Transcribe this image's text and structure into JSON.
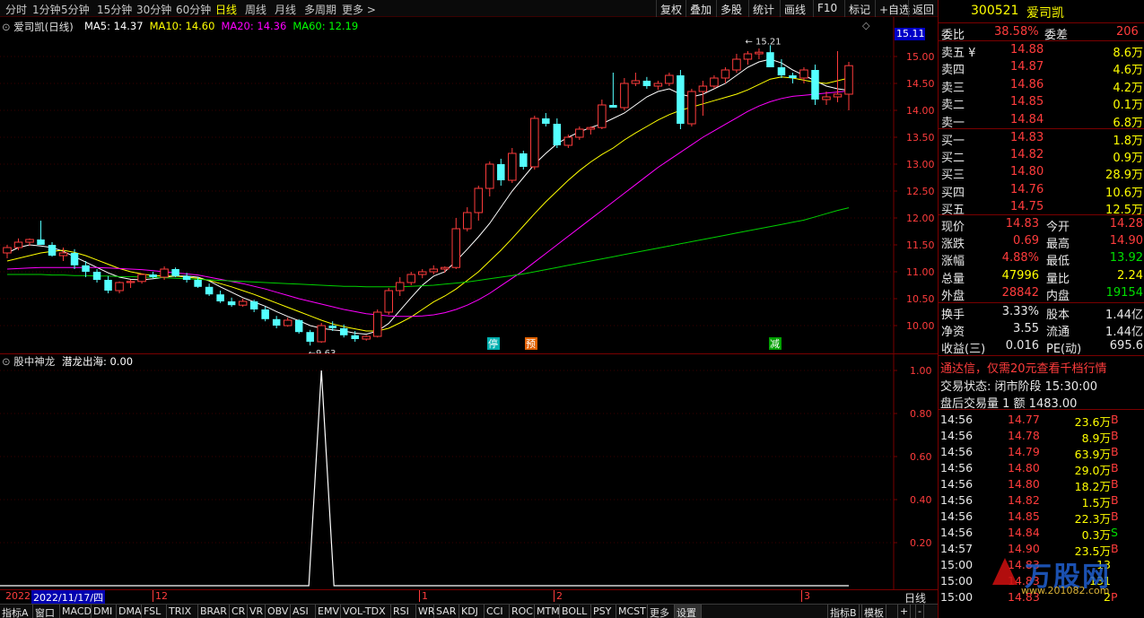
{
  "toolbar": {
    "periods": [
      "分时",
      "1分钟",
      "5分钟",
      "15分钟",
      "30分钟",
      "60分钟",
      "日线",
      "周线",
      "月线",
      "多周期",
      "更多 >"
    ],
    "active_period": "日线",
    "right_buttons": [
      "复权",
      "叠加",
      "多股",
      "统计",
      "画线",
      "F10",
      "标记",
      "+自选",
      "返回"
    ]
  },
  "kline": {
    "title": "爱司凯(日线)",
    "ma": [
      {
        "label": "MA5: 14.37",
        "color": "#ffffff"
      },
      {
        "label": "MA10: 14.60",
        "color": "#ffff00"
      },
      {
        "label": "MA20: 14.36",
        "color": "#ff00ff"
      },
      {
        "label": "MA60: 12.19",
        "color": "#00ff00"
      }
    ],
    "current_price_tag": "15.11",
    "high_annotation": "15.21",
    "low_annotation": "9.63",
    "signals": [
      "停",
      "预",
      "减"
    ]
  },
  "chart_data": {
    "type": "candlestick",
    "y_axis": {
      "labels": [
        "15.00",
        "14.50",
        "14.00",
        "13.50",
        "13.00",
        "12.50",
        "12.00",
        "11.50",
        "11.00",
        "10.50",
        "10.00"
      ],
      "range": [
        9.6,
        15.4
      ]
    },
    "candles": [
      [
        11.35,
        11.5,
        11.25,
        11.45
      ],
      [
        11.45,
        11.62,
        11.4,
        11.55
      ],
      [
        11.55,
        11.62,
        11.48,
        11.6
      ],
      [
        11.6,
        11.95,
        11.55,
        11.5
      ],
      [
        11.5,
        11.55,
        11.28,
        11.3
      ],
      [
        11.3,
        11.45,
        11.2,
        11.35
      ],
      [
        11.35,
        11.42,
        11.05,
        11.12
      ],
      [
        11.12,
        11.2,
        10.9,
        11.0
      ],
      [
        11.0,
        11.05,
        10.8,
        10.85
      ],
      [
        10.85,
        10.92,
        10.6,
        10.65
      ],
      [
        10.65,
        10.82,
        10.6,
        10.8
      ],
      [
        10.8,
        10.85,
        10.7,
        10.82
      ],
      [
        10.82,
        10.97,
        10.78,
        10.95
      ],
      [
        10.95,
        11.0,
        10.88,
        10.9
      ],
      [
        10.9,
        11.1,
        10.85,
        11.05
      ],
      [
        11.05,
        11.08,
        10.9,
        10.92
      ],
      [
        10.92,
        10.98,
        10.8,
        10.85
      ],
      [
        10.85,
        10.9,
        10.7,
        10.72
      ],
      [
        10.72,
        10.78,
        10.55,
        10.58
      ],
      [
        10.58,
        10.65,
        10.42,
        10.45
      ],
      [
        10.45,
        10.52,
        10.35,
        10.38
      ],
      [
        10.38,
        10.5,
        10.35,
        10.45
      ],
      [
        10.45,
        10.48,
        10.25,
        10.3
      ],
      [
        10.3,
        10.35,
        10.08,
        10.12
      ],
      [
        10.12,
        10.18,
        9.95,
        10.0
      ],
      [
        10.0,
        10.15,
        9.98,
        10.1
      ],
      [
        10.1,
        10.12,
        9.85,
        9.88
      ],
      [
        9.88,
        9.92,
        9.63,
        9.7
      ],
      [
        9.7,
        10.05,
        9.68,
        10.0
      ],
      [
        10.0,
        10.08,
        9.9,
        9.95
      ],
      [
        9.95,
        10.02,
        9.78,
        9.82
      ],
      [
        9.82,
        9.9,
        9.7,
        9.75
      ],
      [
        9.75,
        9.82,
        9.72,
        9.8
      ],
      [
        9.8,
        10.3,
        9.78,
        10.25
      ],
      [
        10.25,
        10.7,
        10.2,
        10.65
      ],
      [
        10.65,
        10.9,
        10.55,
        10.8
      ],
      [
        10.8,
        11.0,
        10.75,
        10.95
      ],
      [
        10.95,
        11.05,
        10.88,
        11.0
      ],
      [
        11.0,
        11.12,
        10.95,
        11.05
      ],
      [
        11.05,
        11.1,
        10.98,
        11.08
      ],
      [
        11.08,
        12.0,
        11.05,
        11.8
      ],
      [
        11.8,
        12.2,
        11.75,
        12.1
      ],
      [
        12.1,
        12.6,
        11.95,
        12.55
      ],
      [
        12.55,
        13.05,
        12.4,
        13.0
      ],
      [
        13.0,
        13.1,
        12.6,
        12.7
      ],
      [
        12.7,
        13.3,
        12.65,
        13.2
      ],
      [
        13.2,
        13.25,
        12.9,
        12.95
      ],
      [
        12.95,
        13.9,
        12.9,
        13.85
      ],
      [
        13.85,
        13.95,
        13.7,
        13.75
      ],
      [
        13.75,
        13.85,
        13.3,
        13.35
      ],
      [
        13.35,
        13.55,
        13.3,
        13.5
      ],
      [
        13.5,
        13.7,
        13.45,
        13.65
      ],
      [
        13.65,
        13.7,
        13.55,
        13.68
      ],
      [
        13.68,
        14.2,
        13.65,
        14.1
      ],
      [
        14.1,
        14.7,
        14.05,
        14.05
      ],
      [
        14.05,
        14.6,
        14.0,
        14.5
      ],
      [
        14.5,
        14.7,
        14.45,
        14.55
      ],
      [
        14.55,
        14.62,
        14.4,
        14.45
      ],
      [
        14.45,
        14.55,
        14.38,
        14.5
      ],
      [
        14.5,
        14.7,
        14.45,
        14.65
      ],
      [
        14.65,
        14.75,
        13.65,
        13.75
      ],
      [
        13.75,
        14.4,
        13.7,
        14.35
      ],
      [
        14.35,
        14.55,
        13.9,
        14.45
      ],
      [
        14.45,
        14.65,
        14.4,
        14.6
      ],
      [
        14.6,
        14.8,
        14.5,
        14.75
      ],
      [
        14.75,
        15.05,
        14.7,
        14.95
      ],
      [
        14.95,
        15.1,
        14.85,
        15.05
      ],
      [
        15.05,
        15.15,
        14.95,
        15.08
      ],
      [
        15.08,
        15.21,
        14.95,
        14.8
      ],
      [
        14.8,
        14.95,
        14.6,
        14.65
      ],
      [
        14.65,
        14.7,
        14.5,
        14.6
      ],
      [
        14.6,
        14.8,
        14.5,
        14.75
      ],
      [
        14.75,
        14.85,
        14.1,
        14.2
      ],
      [
        14.2,
        14.35,
        14.1,
        14.25
      ],
      [
        14.25,
        15.1,
        14.15,
        14.3
      ],
      [
        14.3,
        14.9,
        14.0,
        14.83
      ]
    ],
    "ma_lines": {
      "MA5": [
        11.35,
        11.45,
        11.5,
        11.48,
        11.45,
        11.38,
        11.28,
        11.18,
        11.08,
        10.98,
        10.9,
        10.86,
        10.85,
        10.87,
        10.9,
        10.92,
        10.92,
        10.9,
        10.83,
        10.72,
        10.62,
        10.52,
        10.44,
        10.36,
        10.26,
        10.17,
        10.09,
        10.0,
        9.95,
        9.92,
        9.9,
        9.86,
        9.84,
        9.9,
        10.04,
        10.28,
        10.52,
        10.75,
        10.92,
        11.0,
        11.2,
        11.42,
        11.65,
        11.9,
        12.2,
        12.5,
        12.75,
        13.0,
        13.2,
        13.38,
        13.5,
        13.6,
        13.68,
        13.75,
        13.85,
        13.95,
        14.1,
        14.25,
        14.35,
        14.4,
        14.3,
        14.25,
        14.3,
        14.4,
        14.5,
        14.65,
        14.8,
        14.9,
        14.95,
        14.88,
        14.75,
        14.65,
        14.55,
        14.45,
        14.4,
        14.37
      ],
      "MA10": [
        11.2,
        11.25,
        11.3,
        11.35,
        11.38,
        11.4,
        11.36,
        11.3,
        11.22,
        11.14,
        11.06,
        11.0,
        10.96,
        10.93,
        10.92,
        10.92,
        10.9,
        10.88,
        10.84,
        10.78,
        10.72,
        10.65,
        10.58,
        10.5,
        10.42,
        10.34,
        10.26,
        10.18,
        10.1,
        10.03,
        9.98,
        9.94,
        9.9,
        9.9,
        9.95,
        10.05,
        10.16,
        10.3,
        10.44,
        10.55,
        10.68,
        10.84,
        11.0,
        11.2,
        11.4,
        11.62,
        11.85,
        12.08,
        12.3,
        12.5,
        12.7,
        12.88,
        13.04,
        13.18,
        13.3,
        13.45,
        13.58,
        13.7,
        13.82,
        13.92,
        14.0,
        14.06,
        14.12,
        14.18,
        14.24,
        14.3,
        14.38,
        14.48,
        14.58,
        14.62,
        14.6,
        14.56,
        14.52,
        14.5,
        14.55,
        14.6
      ],
      "MA20": [
        11.05,
        11.06,
        11.07,
        11.08,
        11.08,
        11.08,
        11.08,
        11.08,
        11.08,
        11.07,
        11.06,
        11.05,
        11.04,
        11.02,
        11.0,
        10.98,
        10.96,
        10.94,
        10.9,
        10.86,
        10.82,
        10.78,
        10.73,
        10.68,
        10.62,
        10.56,
        10.5,
        10.45,
        10.4,
        10.35,
        10.3,
        10.26,
        10.22,
        10.2,
        10.18,
        10.17,
        10.17,
        10.18,
        10.2,
        10.24,
        10.3,
        10.38,
        10.48,
        10.6,
        10.74,
        10.88,
        11.02,
        11.18,
        11.34,
        11.5,
        11.66,
        11.82,
        11.98,
        12.14,
        12.3,
        12.46,
        12.62,
        12.78,
        12.94,
        13.08,
        13.22,
        13.36,
        13.5,
        13.62,
        13.74,
        13.86,
        13.98,
        14.08,
        14.16,
        14.22,
        14.26,
        14.28,
        14.3,
        14.32,
        14.34,
        14.36
      ],
      "MA60": [
        10.95,
        10.95,
        10.95,
        10.95,
        10.94,
        10.94,
        10.93,
        10.93,
        10.92,
        10.92,
        10.91,
        10.91,
        10.9,
        10.9,
        10.89,
        10.88,
        10.87,
        10.86,
        10.85,
        10.84,
        10.83,
        10.82,
        10.81,
        10.8,
        10.79,
        10.78,
        10.77,
        10.76,
        10.75,
        10.74,
        10.73,
        10.73,
        10.72,
        10.72,
        10.72,
        10.72,
        10.73,
        10.74,
        10.75,
        10.77,
        10.79,
        10.81,
        10.84,
        10.87,
        10.9,
        10.93,
        10.96,
        11.0,
        11.04,
        11.08,
        11.12,
        11.16,
        11.2,
        11.24,
        11.28,
        11.32,
        11.36,
        11.4,
        11.44,
        11.48,
        11.52,
        11.56,
        11.6,
        11.64,
        11.68,
        11.72,
        11.76,
        11.8,
        11.84,
        11.88,
        11.92,
        11.96,
        12.02,
        12.08,
        12.14,
        12.19
      ]
    },
    "indicator": {
      "title": "股中神龙",
      "series_label": "潜龙出海: 0.00",
      "y_labels": [
        "1.00",
        "0.80",
        "0.60",
        "0.40",
        "0.20"
      ],
      "spike_index": 28,
      "spike_value": 1.0
    }
  },
  "datestrip": {
    "year": "2022",
    "cursor_date": "2022/11/17/四",
    "months": [
      "12",
      "1",
      "2",
      "3"
    ],
    "period": "日线"
  },
  "indicator_tabs": [
    "指标A",
    "窗口",
    "MACD",
    "DMI",
    "DMA",
    "FSL",
    "TRIX",
    "BRAR",
    "CR",
    "VR",
    "OBV",
    "ASI",
    "EMV",
    "VOL-TDX",
    "RSI",
    "WR",
    "SAR",
    "KDJ",
    "CCI",
    "ROC",
    "MTM",
    "BOLL",
    "PSY",
    "MCST",
    "更多",
    "设置"
  ],
  "indicator_tabs_right": [
    "指标B",
    "模板",
    "+",
    "-"
  ],
  "quote": {
    "code": "300521",
    "name": "爱司凯",
    "weibi_label": "委比",
    "weibi_value": "38.58%",
    "weicha_label": "委差",
    "weicha_value": "206",
    "sell": [
      {
        "label": "卖五 ¥",
        "price": "14.88",
        "vol": "8.6万"
      },
      {
        "label": "卖四",
        "price": "14.87",
        "vol": "4.6万"
      },
      {
        "label": "卖三",
        "price": "14.86",
        "vol": "4.2万"
      },
      {
        "label": "卖二",
        "price": "14.85",
        "vol": "0.1万"
      },
      {
        "label": "卖一",
        "price": "14.84",
        "vol": "6.8万"
      }
    ],
    "buy": [
      {
        "label": "买一",
        "price": "14.83",
        "vol": "1.8万"
      },
      {
        "label": "买二",
        "price": "14.82",
        "vol": "0.9万"
      },
      {
        "label": "买三",
        "price": "14.80",
        "vol": "28.9万"
      },
      {
        "label": "买四",
        "price": "14.76",
        "vol": "10.6万"
      },
      {
        "label": "买五",
        "price": "14.75",
        "vol": "12.5万"
      }
    ],
    "stats": [
      {
        "l1": "现价",
        "v1": "14.83",
        "l2": "今开",
        "v2": "14.28"
      },
      {
        "l1": "涨跌",
        "v1": "0.69",
        "l2": "最高",
        "v2": "14.90"
      },
      {
        "l1": "涨幅",
        "v1": "4.88%",
        "l2": "最低",
        "v2": "13.92"
      },
      {
        "l1": "总量",
        "v1": "47996",
        "l2": "量比",
        "v2": "2.24"
      },
      {
        "l1": "外盘",
        "v1": "28842",
        "l2": "内盘",
        "v2": "19154"
      }
    ],
    "finance": [
      {
        "l1": "换手",
        "v1": "3.33%",
        "l2": "股本",
        "v2": "1.44亿"
      },
      {
        "l1": "净资",
        "v1": "3.55",
        "l2": "流通",
        "v2": "1.44亿"
      },
      {
        "l1": "收益(三)",
        "v1": "0.016",
        "l2": "PE(动)",
        "v2": "695.6"
      }
    ],
    "promo": "通达信，仅需20元查看千档行情",
    "trade_status": "交易状态: 闭市阶段 15:30:00",
    "after_hours": "盘后交易量 1 额 1483.00",
    "ticks": [
      {
        "t": "14:56",
        "p": "14.77",
        "v": "23.6万",
        "d": "B"
      },
      {
        "t": "14:56",
        "p": "14.78",
        "v": "8.9万",
        "d": "B"
      },
      {
        "t": "14:56",
        "p": "14.79",
        "v": "63.9万",
        "d": "B"
      },
      {
        "t": "14:56",
        "p": "14.80",
        "v": "29.0万",
        "d": "B"
      },
      {
        "t": "14:56",
        "p": "14.80",
        "v": "18.2万",
        "d": "B"
      },
      {
        "t": "14:56",
        "p": "14.82",
        "v": "1.5万",
        "d": "B"
      },
      {
        "t": "14:56",
        "p": "14.85",
        "v": "22.3万",
        "d": "B"
      },
      {
        "t": "14:56",
        "p": "14.84",
        "v": "0.3万",
        "d": "S"
      },
      {
        "t": "14:57",
        "p": "14.90",
        "v": "23.5万",
        "d": "B"
      },
      {
        "t": "15:00",
        "p": "14.83",
        "v": "13",
        "d": ""
      },
      {
        "t": "15:00",
        "p": "14.83",
        "v": "131",
        "d": ""
      },
      {
        "t": "15:00",
        "p": "14.83",
        "v": "2",
        "d": "P"
      }
    ],
    "watermark": "万股网",
    "watermark_url": "www.201082.com"
  }
}
